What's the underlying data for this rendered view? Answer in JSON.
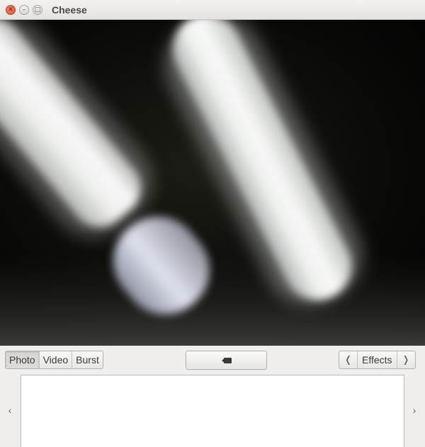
{
  "window": {
    "title": "Cheese",
    "controls": {
      "close_icon": "close-icon",
      "minimize_icon": "minimize-icon",
      "maximize_icon": "maximize-icon"
    }
  },
  "viewport": {
    "content": "webcam-preview"
  },
  "modes": {
    "items": [
      {
        "label": "Photo",
        "active": true
      },
      {
        "label": "Video",
        "active": false
      },
      {
        "label": "Burst",
        "active": false
      }
    ]
  },
  "capture": {
    "icon": "camera-icon"
  },
  "effects": {
    "label": "Effects",
    "prev_icon": "chevron-left-icon",
    "next_icon": "chevron-right-icon"
  },
  "thumbnails": {
    "scroll_left_icon": "chevron-left-icon",
    "scroll_right_icon": "chevron-right-icon",
    "items": []
  }
}
